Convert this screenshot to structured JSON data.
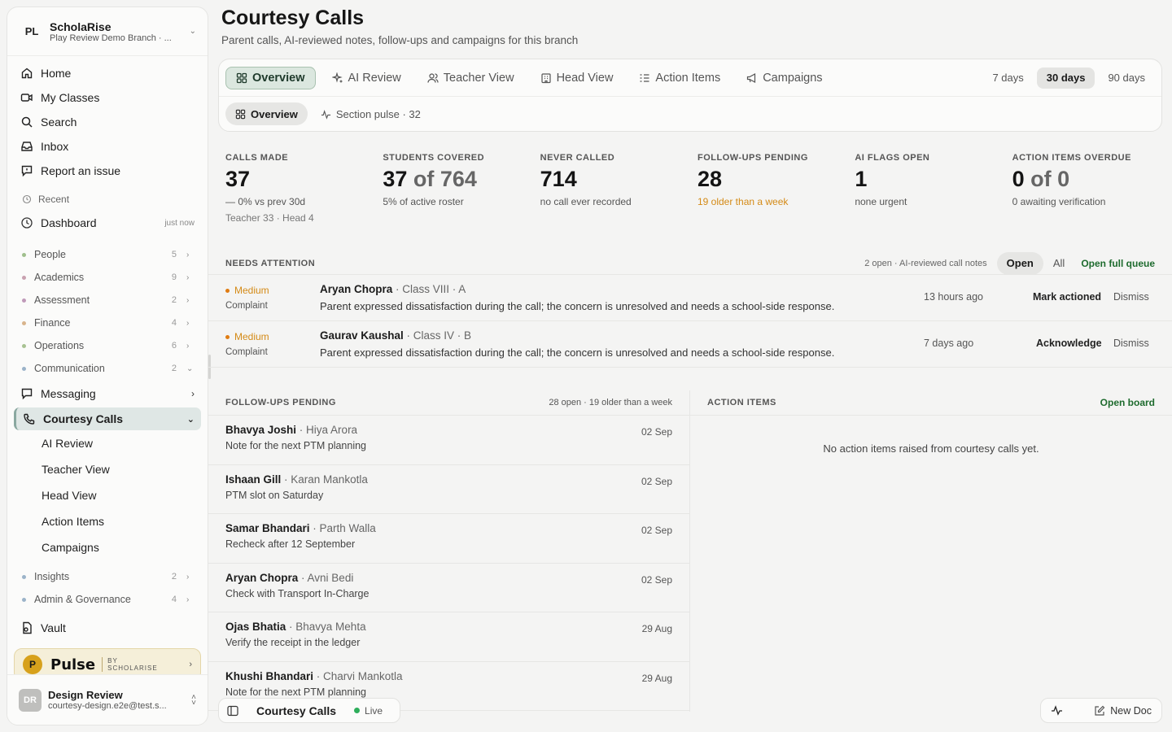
{
  "workspace": {
    "initials": "PL",
    "name": "ScholaRise",
    "branch": "Play Review Demo Branch · ..."
  },
  "nav": [
    {
      "label": "Home",
      "icon": "home-icon"
    },
    {
      "label": "My Classes",
      "icon": "video-icon"
    },
    {
      "label": "Search",
      "icon": "search-icon"
    },
    {
      "label": "Inbox",
      "icon": "inbox-icon"
    },
    {
      "label": "Report an issue",
      "icon": "report-icon"
    }
  ],
  "recent": {
    "label": "Recent",
    "item": "Dashboard",
    "time": "just now"
  },
  "groups_top": [
    {
      "label": "People",
      "count": "5",
      "color": "#9fbf8c"
    },
    {
      "label": "Academics",
      "count": "9",
      "color": "#c9a1b0"
    },
    {
      "label": "Assessment",
      "count": "2",
      "color": "#c09ab9"
    },
    {
      "label": "Finance",
      "count": "4",
      "color": "#d8b48c"
    },
    {
      "label": "Operations",
      "count": "6",
      "color": "#a8c292"
    },
    {
      "label": "Communication",
      "count": "2",
      "color": "#9bb3c9"
    }
  ],
  "messaging": "Messaging",
  "courtesy": "Courtesy Calls",
  "courtesy_sub": [
    "AI Review",
    "Teacher View",
    "Head View",
    "Action Items",
    "Campaigns"
  ],
  "groups_bottom": [
    {
      "label": "Insights",
      "count": "2",
      "color": "#9bb3c9"
    },
    {
      "label": "Admin & Governance",
      "count": "4",
      "color": "#9bb3c9"
    }
  ],
  "vault": "Vault",
  "pulse": {
    "badge": "P",
    "word": "Pulse",
    "by1": "BY",
    "by2": "SCHOLARISE"
  },
  "user": {
    "initials": "DR",
    "name": "Design Review",
    "email": "courtesy-design.e2e@test.s..."
  },
  "page": {
    "title": "Courtesy Calls",
    "subtitle": "Parent calls, AI-reviewed notes, follow-ups and campaigns for this branch"
  },
  "tabs": [
    {
      "label": "Overview",
      "icon": "grid-icon"
    },
    {
      "label": "AI Review",
      "icon": "sparkle-icon"
    },
    {
      "label": "Teacher View",
      "icon": "users-icon"
    },
    {
      "label": "Head View",
      "icon": "building-icon"
    },
    {
      "label": "Action Items",
      "icon": "list-icon"
    },
    {
      "label": "Campaigns",
      "icon": "megaphone-icon"
    }
  ],
  "ranges": [
    "7 days",
    "30 days",
    "90 days"
  ],
  "active_range": "30 days",
  "subtabs": [
    {
      "label": "Overview",
      "icon": "grid-icon"
    },
    {
      "label": "Section pulse · 32",
      "icon": "pulse-icon"
    }
  ],
  "kpis": [
    {
      "label": "CALLS MADE",
      "value": "37",
      "of": "",
      "note": "— 0% vs prev 30d",
      "note2": "Teacher 33 · Head 4",
      "warn": false
    },
    {
      "label": "STUDENTS COVERED",
      "value": "37",
      "of": " of 764",
      "note": "5% of active roster",
      "note2": "",
      "warn": false
    },
    {
      "label": "NEVER CALLED",
      "value": "714",
      "of": "",
      "note": "no call ever recorded",
      "note2": "",
      "warn": false
    },
    {
      "label": "FOLLOW-UPS PENDING",
      "value": "28",
      "of": "",
      "note": "19 older than a week",
      "note2": "",
      "warn": true
    },
    {
      "label": "AI FLAGS OPEN",
      "value": "1",
      "of": "",
      "note": "none urgent",
      "note2": "",
      "warn": false
    },
    {
      "label": "ACTION ITEMS OVERDUE",
      "value": "0",
      "of": " of 0",
      "note": "0 awaiting verification",
      "note2": "",
      "warn": false
    }
  ],
  "attention": {
    "label": "NEEDS ATTENTION",
    "meta": "2 open · AI-reviewed call notes",
    "filter_open": "Open",
    "filter_all": "All",
    "queue_link": "Open full queue",
    "rows": [
      {
        "severity": "Medium",
        "category": "Complaint",
        "student": "Aryan Chopra",
        "cls": " · Class VIII · A",
        "desc": "Parent expressed dissatisfaction during the call; the concern is unresolved and needs a school-side response.",
        "time": "13 hours ago",
        "action": "Mark actioned",
        "dismiss": "Dismiss"
      },
      {
        "severity": "Medium",
        "category": "Complaint",
        "student": "Gaurav Kaushal",
        "cls": " · Class IV · B",
        "desc": "Parent expressed dissatisfaction during the call; the concern is unresolved and needs a school-side response.",
        "time": "7 days ago",
        "action": "Acknowledge",
        "dismiss": "Dismiss"
      }
    ]
  },
  "followups": {
    "label": "FOLLOW-UPS PENDING",
    "meta": "28 open · 19 older than a week",
    "rows": [
      {
        "student": "Bhavya Joshi",
        "parent": " · Hiya Arora",
        "note": "Note for the next PTM planning",
        "date": "02 Sep"
      },
      {
        "student": "Ishaan Gill",
        "parent": " · Karan Mankotla",
        "note": "PTM slot on Saturday",
        "date": "02 Sep"
      },
      {
        "student": "Samar Bhandari",
        "parent": " · Parth Walla",
        "note": "Recheck after 12 September",
        "date": "02 Sep"
      },
      {
        "student": "Aryan Chopra",
        "parent": " · Avni Bedi",
        "note": "Check with Transport In-Charge",
        "date": "02 Sep"
      },
      {
        "student": "Ojas Bhatia",
        "parent": " · Bhavya Mehta",
        "note": "Verify the receipt in the ledger",
        "date": "29 Aug"
      },
      {
        "student": "Khushi Bhandari",
        "parent": " · Charvi Mankotla",
        "note": "Note for the next PTM planning",
        "date": "29 Aug"
      }
    ]
  },
  "action_items": {
    "label": "ACTION ITEMS",
    "link": "Open board",
    "empty": "No action items raised from courtesy calls yet."
  },
  "bottombar": {
    "title": "Courtesy Calls",
    "live": "Live",
    "new_doc": "New Doc"
  }
}
